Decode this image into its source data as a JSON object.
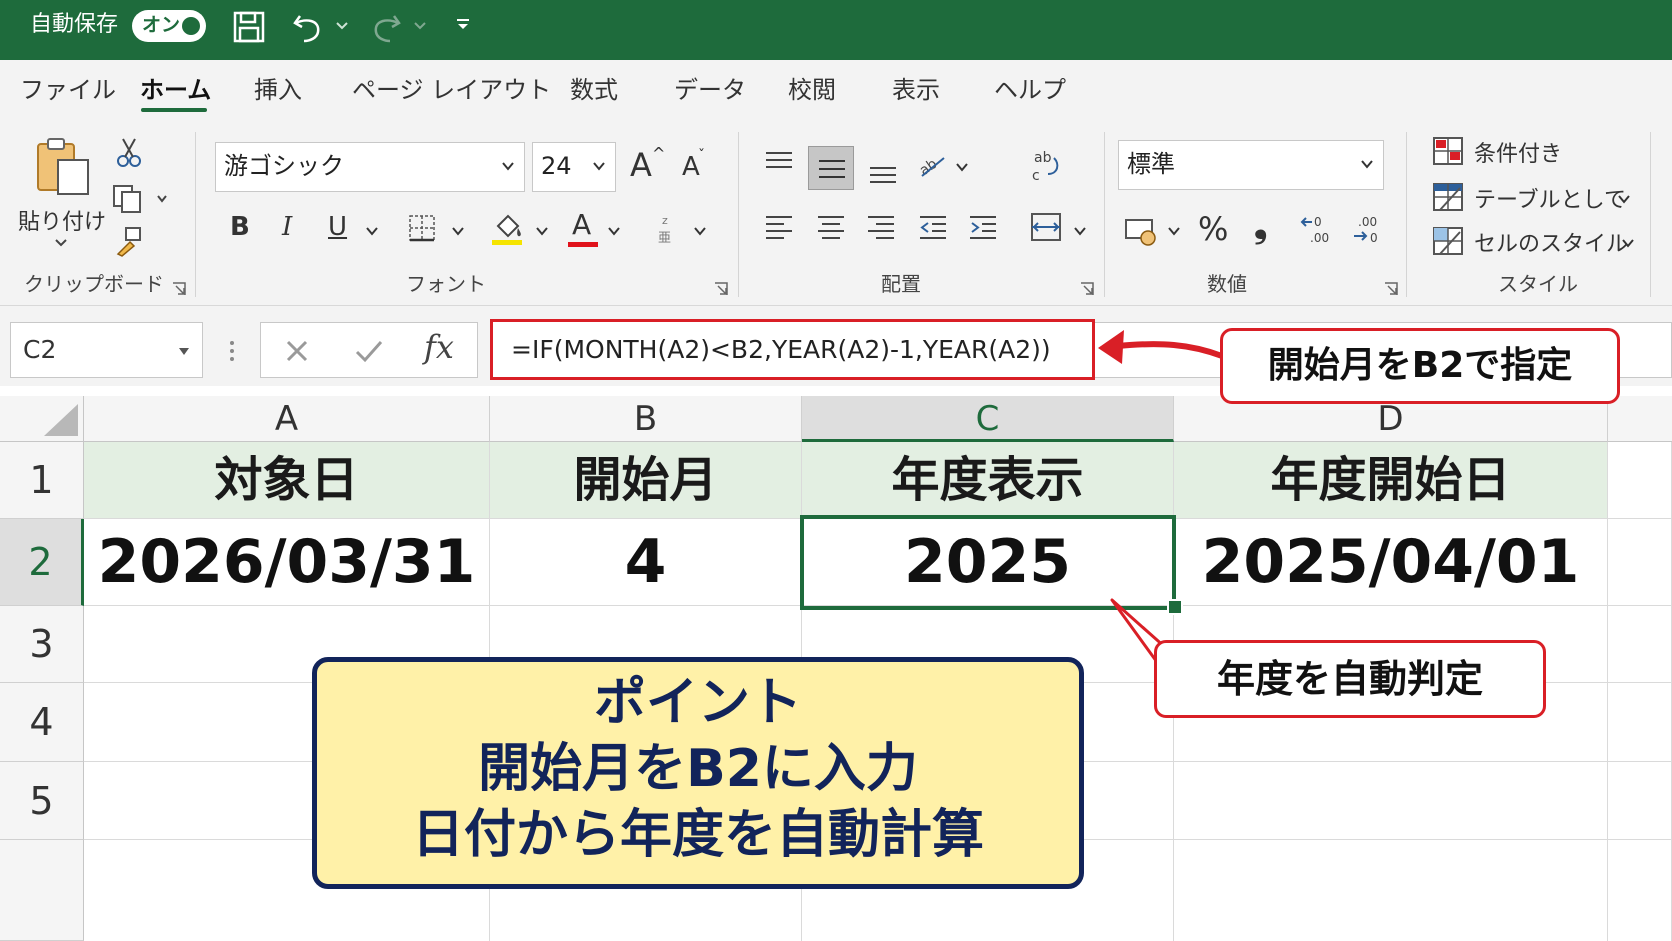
{
  "title_bar": {
    "autosave_label": "自動保存",
    "autosave_toggle": "オン"
  },
  "ribbon_tabs": [
    "ファイル",
    "ホーム",
    "挿入",
    "ページ レイアウト",
    "数式",
    "データ",
    "校閲",
    "表示",
    "ヘルプ"
  ],
  "active_tab": "ホーム",
  "clipboard": {
    "paste_label": "貼り付け",
    "group_label": "クリップボード"
  },
  "font": {
    "font_name": "游ゴシック",
    "font_size": "24",
    "group_label": "フォント",
    "bold": "B",
    "italic": "I",
    "underline": "U",
    "font_color_glyph": "A",
    "grow_glyph": "A",
    "shrink_glyph": "A",
    "highlight_color": "#f5e400",
    "font_color": "#e0121b"
  },
  "alignment": {
    "group_label": "配置"
  },
  "number": {
    "format": "標準",
    "group_label": "数値",
    "percent": "%",
    "comma": "❟"
  },
  "styles": {
    "group_label": "スタイル",
    "conditional": "条件付き",
    "as_table": "テーブルとして",
    "cell_styles": "セルのスタイル"
  },
  "formula_bar": {
    "name_box": "C2",
    "formula": "=IF(MONTH(A2)<B2,YEAR(A2)-1,YEAR(A2))"
  },
  "sheet": {
    "columns": [
      "A",
      "B",
      "C",
      "D"
    ],
    "rows": [
      "1",
      "2",
      "3",
      "4",
      "5"
    ],
    "header_row": [
      "対象日",
      "開始月",
      "年度表示",
      "年度開始日"
    ],
    "data_row": [
      "2026/03/31",
      "4",
      "2025",
      "2025/04/01"
    ],
    "selected_cell": "C2"
  },
  "annotations": {
    "formula_note": "開始月をB2で指定",
    "cell_note": "年度を自動判定",
    "point_lines": [
      "ポイント",
      "開始月をB2に入力",
      "日付から年度を自動計算"
    ]
  },
  "colors": {
    "excel_green": "#1e6b3c",
    "callout_red": "#d91f26",
    "point_fill": "#fff1a8",
    "point_border": "#12245a",
    "header_fill": "#e3efe2"
  }
}
